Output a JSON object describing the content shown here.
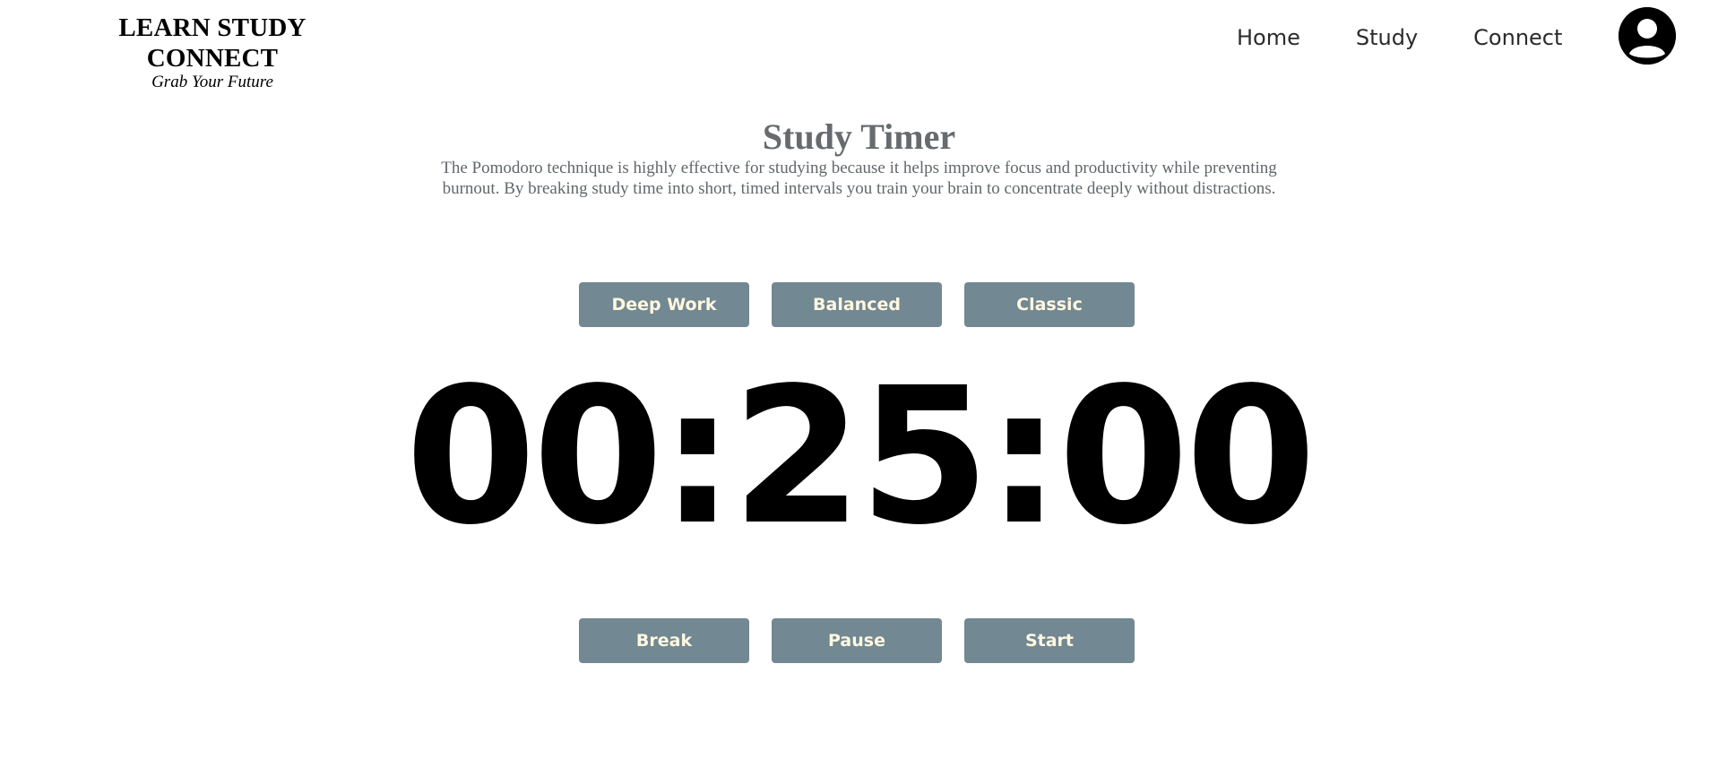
{
  "brand": {
    "title": "LEARN STUDY CONNECT",
    "tagline": "Grab Your Future"
  },
  "nav": {
    "items": [
      {
        "label": "Home"
      },
      {
        "label": "Study"
      },
      {
        "label": "Connect"
      }
    ],
    "avatar_icon": "user-avatar-icon"
  },
  "main": {
    "title": "Study Timer",
    "description": "The Pomodoro technique is highly effective for studying because it helps improve focus and productivity while preventing burnout. By breaking study time into short, timed intervals you train your brain to concentrate deeply without distractions."
  },
  "presets": [
    {
      "label": "Deep Work"
    },
    {
      "label": "Balanced"
    },
    {
      "label": "Classic"
    }
  ],
  "timer": {
    "display": "00:25:00"
  },
  "controls": [
    {
      "label": "Break"
    },
    {
      "label": "Pause"
    },
    {
      "label": "Start"
    }
  ],
  "colors": {
    "button_bg": "#728892",
    "button_text": "#fff8e1",
    "title": "#676b6e",
    "timer": "#000000"
  }
}
